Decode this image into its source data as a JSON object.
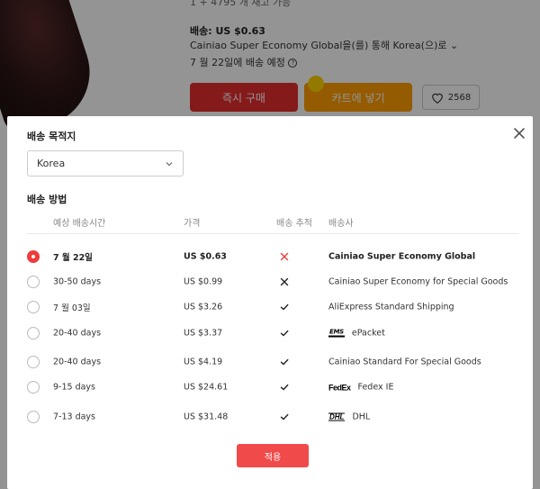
{
  "background": {
    "quantity_text": "1  +  4795 개 재고 가능",
    "shipping_fee": "배송: US $0.63",
    "shipping_via": "Cainiao Super Economy Global을(를) 통해 Korea(으)로 ⌄",
    "delivery_date": "7 월 22일에 배송 예정",
    "buy_now": "즉시 구매",
    "add_to_cart": "카트에 넣기",
    "wishlist_count": "2568"
  },
  "modal": {
    "destination_title": "배송 목적지",
    "country": "Korea",
    "method_title": "배송 방법",
    "columns": {
      "time": "예상 배송시간",
      "price": "가격",
      "tracking": "배송 추적",
      "carrier": "배송사"
    },
    "options": [
      {
        "time": "7 월 22일",
        "price": "US $0.63",
        "tracking": "none-red",
        "carrier": "Cainiao Super Economy Global",
        "logo": "",
        "selected": true
      },
      {
        "time": "30-50 days",
        "price": "US $0.99",
        "tracking": "none",
        "carrier": "Cainiao Super Economy for Special Goods",
        "logo": "",
        "selected": false
      },
      {
        "time": "7 월 03일",
        "price": "US $3.26",
        "tracking": "yes",
        "carrier": "AliExpress Standard Shipping",
        "logo": "",
        "selected": false
      },
      {
        "time": "20-40 days",
        "price": "US $3.37",
        "tracking": "yes",
        "carrier": "ePacket",
        "logo": "EMS",
        "selected": false
      },
      {
        "time": "20-40 days",
        "price": "US $4.19",
        "tracking": "yes",
        "carrier": "Cainiao Standard For Special Goods",
        "logo": "",
        "selected": false
      },
      {
        "time": "9-15 days",
        "price": "US $24.61",
        "tracking": "yes",
        "carrier": "Fedex IE",
        "logo": "FedEx",
        "selected": false
      },
      {
        "time": "7-13 days",
        "price": "US $31.48",
        "tracking": "yes",
        "carrier": "DHL",
        "logo": "DHL",
        "selected": false
      }
    ],
    "apply_label": "적용"
  },
  "colors": {
    "accent": "#f04a4a",
    "cart": "#ff9e00",
    "buy": "#e52d2d"
  }
}
